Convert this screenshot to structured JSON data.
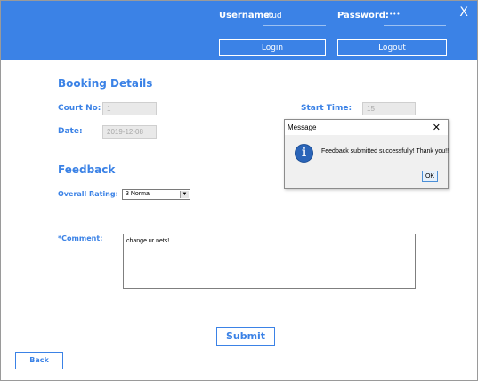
{
  "header": {
    "username_label": "Username:",
    "username_value": "stud",
    "password_label": "Password:",
    "password_value": "••••",
    "close_label": "X",
    "login_label": "Login",
    "logout_label": "Logout"
  },
  "booking": {
    "section_title": "Booking Details",
    "court_label": "Court No:",
    "court_value": "1",
    "start_label": "Start Time:",
    "start_value": "15",
    "date_label": "Date:",
    "date_value": "2019-12-08"
  },
  "feedback": {
    "section_title": "Feedback",
    "rating_label": "Overall Rating:",
    "rating_value": "3 Normal",
    "comment_label": "*Comment:",
    "comment_value": "change ur nets!"
  },
  "buttons": {
    "submit_label": "Submit",
    "back_label": "Back"
  },
  "dialog": {
    "title": "Message",
    "close": "✕",
    "icon_letter": "i",
    "message": "Feedback submitted successfully! Thank you!!",
    "ok_label": "OK"
  },
  "colors": {
    "accent": "#3b82e6",
    "info_icon": "#2a64b8"
  }
}
